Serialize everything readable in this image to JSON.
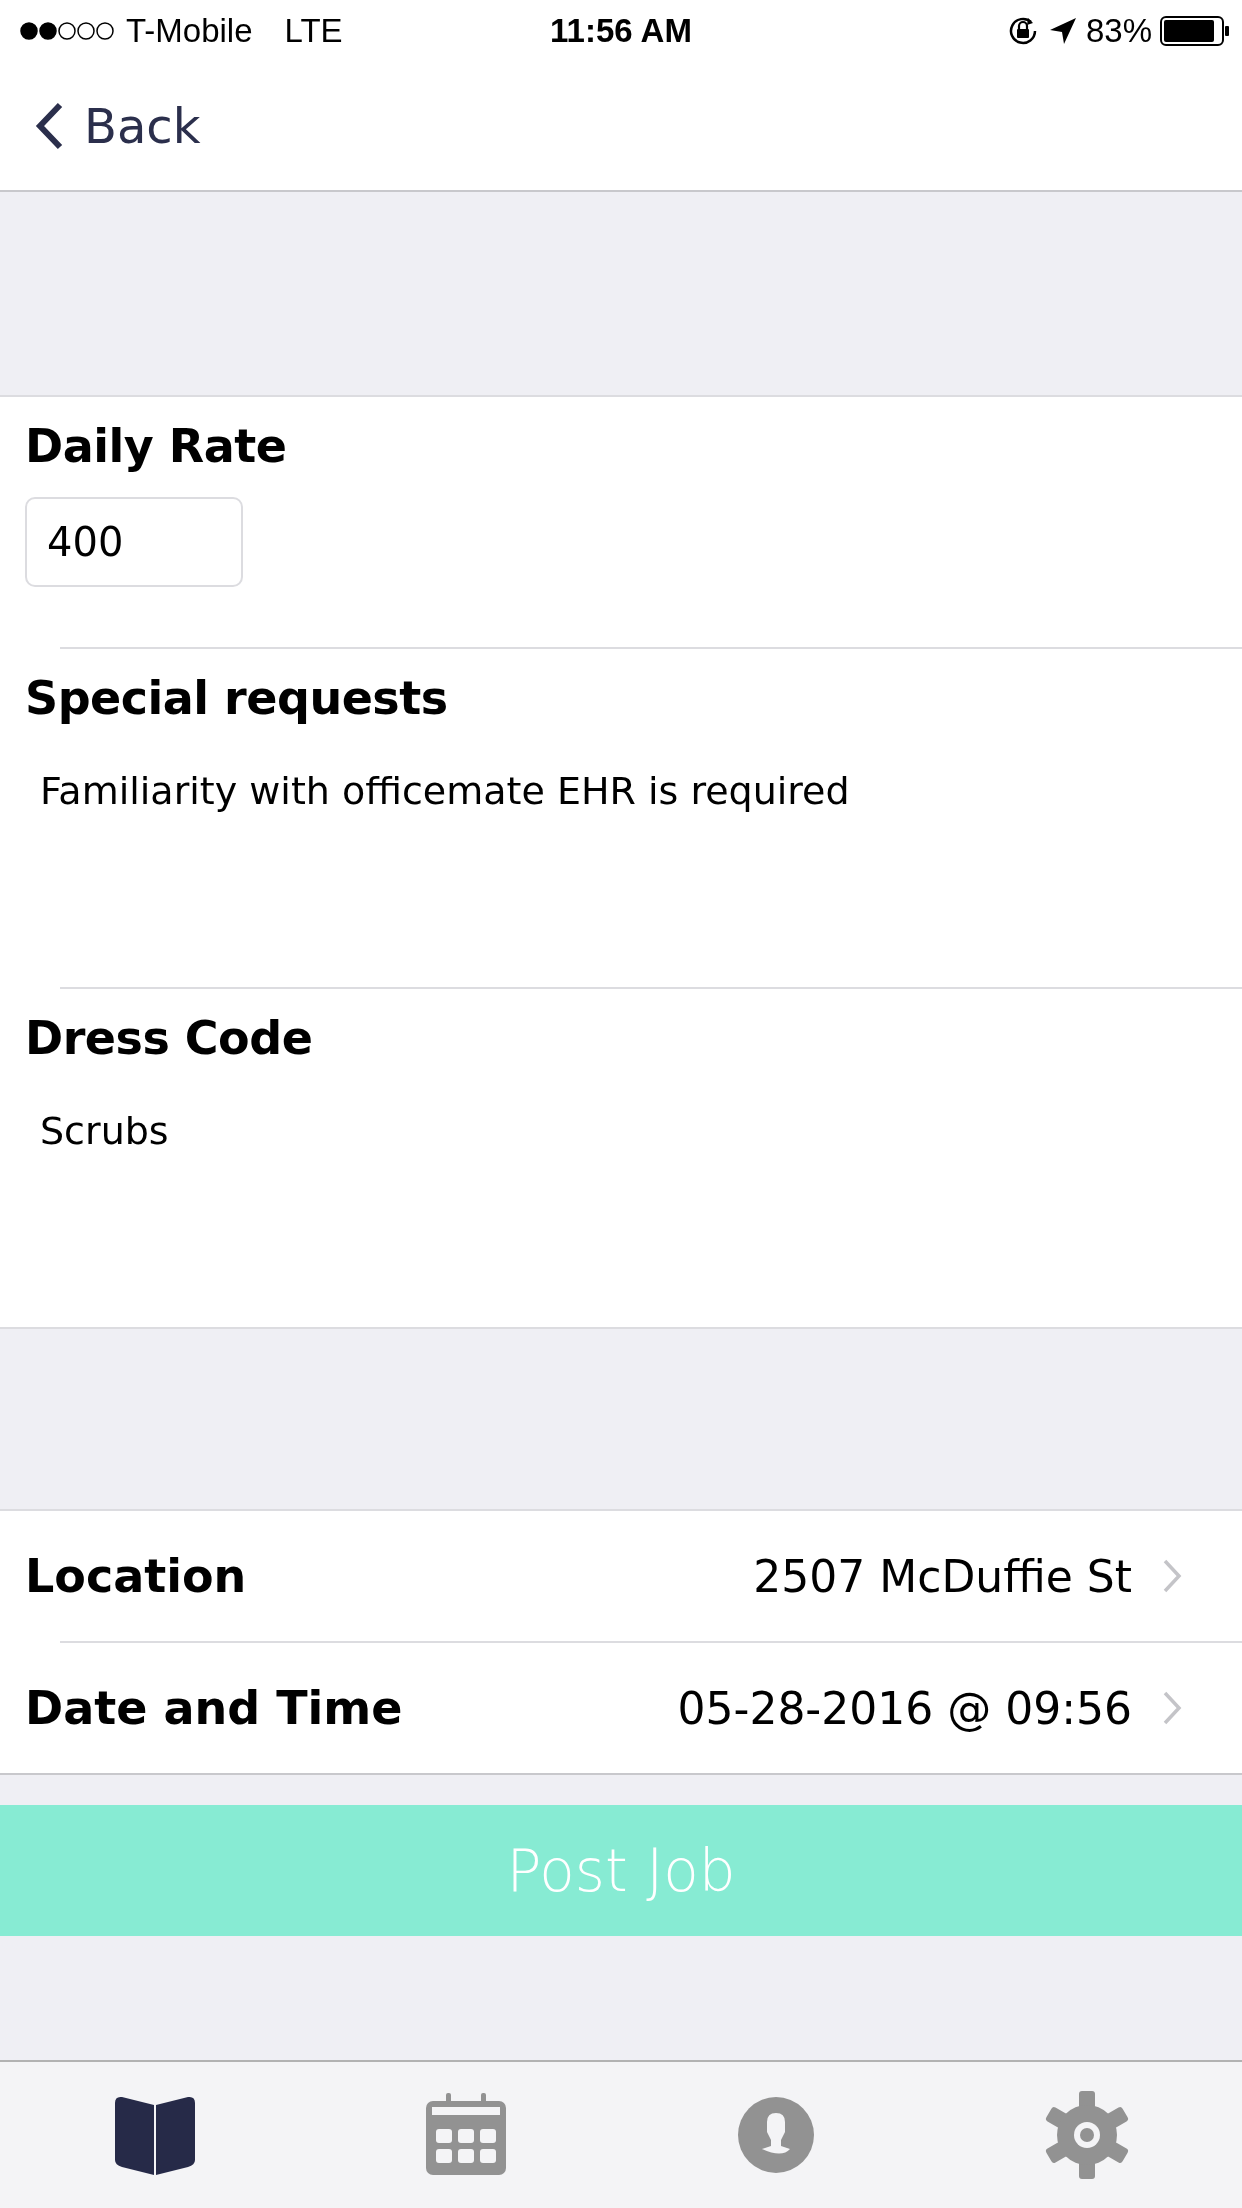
{
  "status_bar": {
    "carrier": "T-Mobile",
    "network": "LTE",
    "time": "11:56 AM",
    "battery": "83%"
  },
  "nav": {
    "back": "Back"
  },
  "sections": [
    {
      "title": "Daily Rate",
      "kind": "input",
      "value": "400"
    },
    {
      "title": "Special requests",
      "kind": "text",
      "value": "Familiarity with officemate EHR is required"
    },
    {
      "title": "Dress Code",
      "kind": "text",
      "value": "Scrubs"
    }
  ],
  "rows": [
    {
      "label": "Location",
      "value": "2507 McDuffie St"
    },
    {
      "label": "Date and Time",
      "value": "05-28-2016 @ 09:56"
    }
  ],
  "post_button": "Post Job",
  "tabs": [
    {
      "kind": "book",
      "selected": true
    },
    {
      "kind": "calendar",
      "selected": false
    },
    {
      "kind": "profile",
      "selected": false
    },
    {
      "kind": "settings",
      "selected": false
    }
  ]
}
